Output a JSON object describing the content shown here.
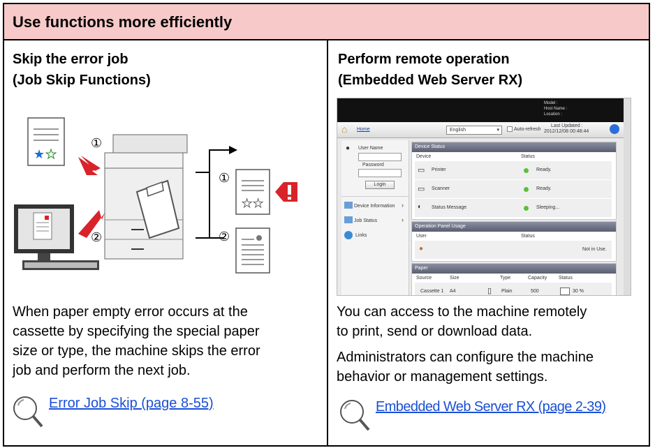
{
  "header": {
    "title": "Use functions more efficiently"
  },
  "left": {
    "title_line1": "Skip the error job",
    "title_line2": "(Job Skip Functions)",
    "figure": {
      "marker1": "①",
      "marker2": "②",
      "out1": "①",
      "out2": "②"
    },
    "description": [
      "When paper empty error occurs at the",
      "cassette by specifying the special paper",
      "size or type, the machine skips the error",
      "job and perform the next job."
    ],
    "link": "Error Job Skip (page 8-55)"
  },
  "right": {
    "title_line1": "Perform remote operation",
    "title_line2": "(Embedded Web Server RX)",
    "description1": [
      "You can access to the machine remotely",
      "to print, send or download data."
    ],
    "description2": [
      "Administrators can configure the machine",
      "behavior or management settings."
    ],
    "link": "Embedded Web Server RX (page 2-39)"
  },
  "webserver": {
    "info": [
      "Model :",
      "Host Name :",
      "Location :"
    ],
    "home": "Home",
    "language": "English",
    "auto_refresh": "Auto-refresh",
    "last_updated_label": "Last Updated :",
    "last_updated_value": "2012/12/08 00:48:44",
    "user_name": "User Name",
    "password": "Password",
    "login": "Login",
    "nav": [
      "Device Information",
      "Job Status",
      "Links"
    ],
    "device_status": {
      "title": "Device Status",
      "col_device": "Device",
      "col_status": "Status",
      "rows": [
        {
          "device": "Printer",
          "status": "Ready."
        },
        {
          "device": "Scanner",
          "status": "Ready."
        },
        {
          "device": "Status Message",
          "status": "Sleeping..."
        }
      ]
    },
    "op_panel": {
      "title": "Operation Panel Usage",
      "col_user": "User",
      "col_status": "Status",
      "status": "Not in Use."
    },
    "paper": {
      "title": "Paper",
      "cols": [
        "Source",
        "Size",
        "Type",
        "Capacity",
        "Status"
      ],
      "row": {
        "source": "Cassette 1",
        "size": "A4",
        "type": "Plain",
        "capacity": "500",
        "status": "30 %"
      }
    }
  },
  "colors": {
    "header_bg": "#f7c9c9",
    "link": "#1a4fd6",
    "alert": "#d8232a"
  }
}
